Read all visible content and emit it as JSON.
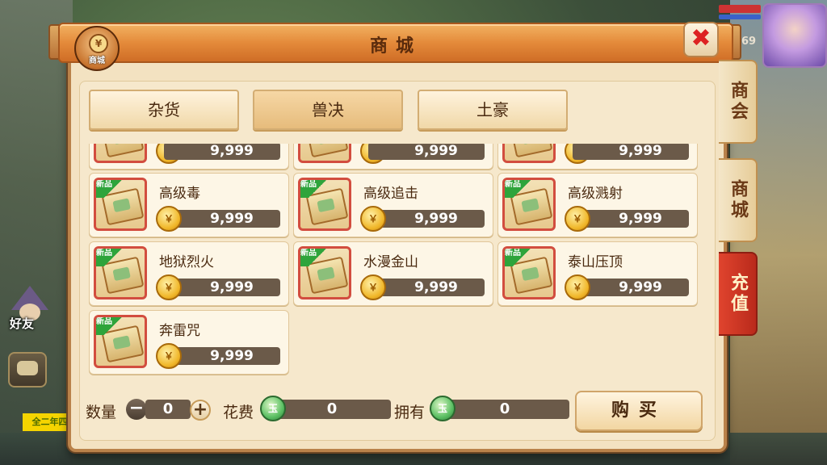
{
  "colors": {
    "title_orange": "#e48a3a",
    "panel_bg": "#f3e2c1",
    "item_border_red": "#d24d3f",
    "price_bar": "#6b5a49",
    "recharge_red": "#e0442e",
    "new_badge_green": "#2ea43b"
  },
  "hud": {
    "level": "69",
    "friend_label": "好友",
    "chat_strip": "全二年四品"
  },
  "window": {
    "title": "商城",
    "emblem_label": "商城",
    "emblem_coin": "¥",
    "close_symbol": "✖"
  },
  "side_tabs": [
    {
      "label": "商会"
    },
    {
      "label": "商城"
    },
    {
      "label": "充值"
    }
  ],
  "category_tabs": [
    {
      "label": "杂货"
    },
    {
      "label": "兽决"
    },
    {
      "label": "土豪"
    }
  ],
  "items": [
    {
      "name": "",
      "price": "9,999",
      "new": false
    },
    {
      "name": "",
      "price": "9,999",
      "new": false
    },
    {
      "name": "",
      "price": "9,999",
      "new": false
    },
    {
      "name": "高级毒",
      "price": "9,999",
      "new": true
    },
    {
      "name": "高级追击",
      "price": "9,999",
      "new": true
    },
    {
      "name": "高级溅射",
      "price": "9,999",
      "new": true
    },
    {
      "name": "地狱烈火",
      "price": "9,999",
      "new": true
    },
    {
      "name": "水漫金山",
      "price": "9,999",
      "new": true
    },
    {
      "name": "泰山压顶",
      "price": "9,999",
      "new": true
    },
    {
      "name": "奔雷咒",
      "price": "9,999",
      "new": true
    }
  ],
  "badge_text": "新品",
  "coin_symbol": "￥",
  "bottom": {
    "quantity_label": "数量",
    "quantity_value": "0",
    "minus": "−",
    "plus": "+",
    "cost_label": "花费",
    "cost_value": "0",
    "own_label": "拥有",
    "own_value": "0",
    "buy_label": "购买",
    "jade_symbol": "玉"
  }
}
